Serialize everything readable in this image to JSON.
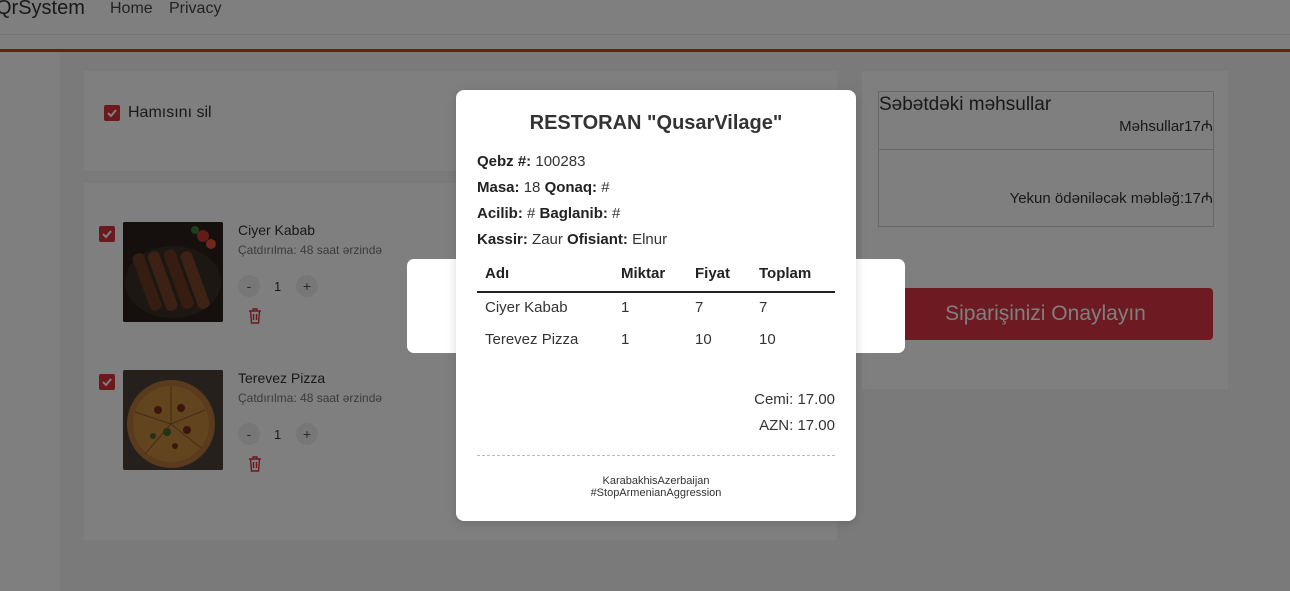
{
  "nav": {
    "brand": "QrSystem",
    "links": [
      "Home",
      "Privacy"
    ]
  },
  "cart": {
    "select_all_label": "Hamısını sil",
    "items": [
      {
        "name": "Ciyer Kabab",
        "delivery": "Çatdırılma: 48 saat ərzində",
        "quantity": "1",
        "minus": "-",
        "plus": "+"
      },
      {
        "name": "Terevez Pizza",
        "delivery": "Çatdırılma: 48 saat ərzində",
        "quantity": "1",
        "minus": "-",
        "plus": "+"
      }
    ]
  },
  "summary": {
    "title": "Səbətdəki məhsullar",
    "products_line": "Məhsullar17₼",
    "total_line": "Yekun ödəniləcək məbləğ:17₼",
    "confirm_button": "Siparişinizi Onaylayın"
  },
  "receipt": {
    "title": "RESTORAN \"QusarVilage\"",
    "receipt_no_label": "Qebz #:",
    "receipt_no": "100283",
    "table_label": "Masa:",
    "table": "18",
    "guest_label": "Qonaq:",
    "guest": "#",
    "opened_label": "Acilib:",
    "opened": "#",
    "closed_label": "Baglanib:",
    "closed": "#",
    "cashier_label": "Kassir:",
    "cashier": "Zaur",
    "waiter_label": "Ofisiant:",
    "waiter": "Elnur",
    "columns": [
      "Adı",
      "Miktar",
      "Fiyat",
      "Toplam"
    ],
    "rows": [
      [
        "Ciyer Kabab",
        "1",
        "7",
        "7"
      ],
      [
        "Terevez Pizza",
        "1",
        "10",
        "10"
      ]
    ],
    "sum_line": "Cemi: 17.00",
    "azn_line": "AZN: 17.00",
    "footer_1": "KarabakhisAzerbaijan",
    "footer_2": "#StopArmenianAggression"
  },
  "colors": {
    "accent": "#e0391f",
    "checkbox": "#d8323a",
    "confirm_button": "#dc3545"
  },
  "icons": [
    "check-icon",
    "trash-icon"
  ]
}
